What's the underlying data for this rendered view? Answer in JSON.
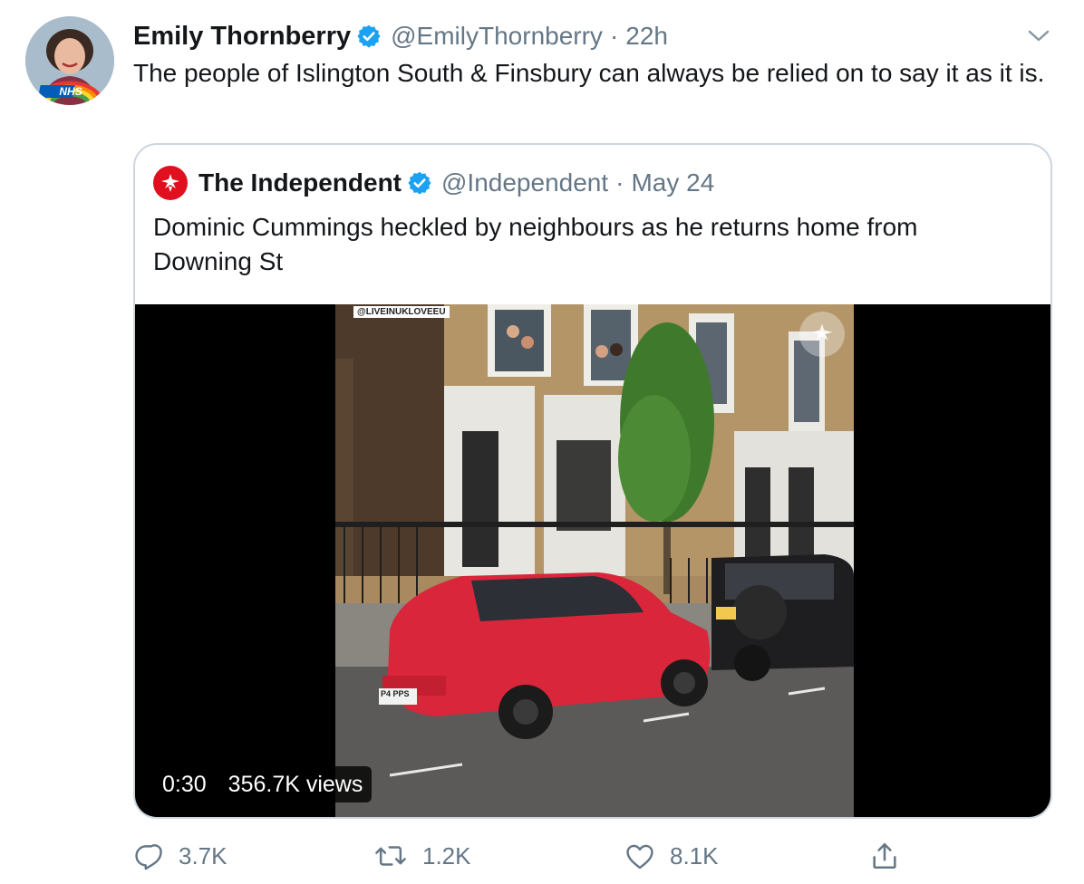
{
  "tweet": {
    "author": {
      "display_name": "Emily Thornberry",
      "handle": "@EmilyThornberry",
      "avatar_badge": "NHS"
    },
    "separator": "·",
    "time": "22h",
    "text": "The people of Islington South & Finsbury can always be relied on to say it as it is."
  },
  "quote": {
    "author": {
      "display_name": "The Independent",
      "handle": "@Independent"
    },
    "separator": "·",
    "time": "May 24",
    "text": "Dominic Cummings heckled by neighbours as he returns home from Downing St",
    "video": {
      "watermark": "@LIVEINUKLOVEEU",
      "plate_front": "P4 PPS",
      "duration": "0:30",
      "views": "356.7K views"
    }
  },
  "actions": {
    "replies": "3.7K",
    "retweets": "1.2K",
    "likes": "8.1K"
  },
  "colors": {
    "text_primary": "#14171a",
    "text_secondary": "#657786",
    "verified_blue": "#1da1f2",
    "border": "#ccd6dd",
    "independent_red": "#e0101e"
  },
  "icons": {
    "verified": "verified-badge-icon",
    "caret": "chevron-down-icon",
    "reply": "reply-icon",
    "retweet": "retweet-icon",
    "like": "heart-icon",
    "share": "share-icon"
  }
}
